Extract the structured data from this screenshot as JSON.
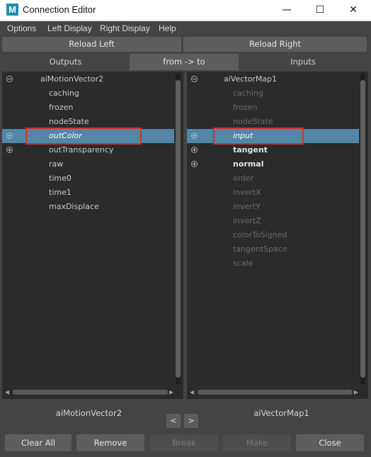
{
  "window": {
    "title": "Connection Editor",
    "app_icon": "M",
    "min_glyph": "—",
    "max_glyph": "☐",
    "close_glyph": "✕"
  },
  "menu": [
    "Options",
    "Left Display",
    "Right Display",
    "Help"
  ],
  "reload": {
    "left": "Reload Left",
    "right": "Reload Right"
  },
  "headers": {
    "outputs": "Outputs",
    "direction": "from -> to",
    "inputs": "Inputs"
  },
  "left_panel": {
    "node": "aiMotionVector2",
    "attributes": [
      {
        "label": "caching"
      },
      {
        "label": "frozen"
      },
      {
        "label": "nodeState"
      },
      {
        "label": "outColor"
      },
      {
        "label": "outTransparency"
      },
      {
        "label": "raw"
      },
      {
        "label": "time0"
      },
      {
        "label": "time1"
      },
      {
        "label": "maxDisplace"
      }
    ]
  },
  "right_panel": {
    "node": "aiVectorMap1",
    "attributes": [
      {
        "label": "caching"
      },
      {
        "label": "frozen"
      },
      {
        "label": "nodeState"
      },
      {
        "label": "input"
      },
      {
        "label": "tangent"
      },
      {
        "label": "normal"
      },
      {
        "label": "order"
      },
      {
        "label": "invertX"
      },
      {
        "label": "invertY"
      },
      {
        "label": "invertZ"
      },
      {
        "label": "colorToSigned"
      },
      {
        "label": "tangentSpace"
      },
      {
        "label": "scale"
      }
    ]
  },
  "footer": {
    "left_node": "aiMotionVector2",
    "right_node": "aiVectorMap1",
    "prev": "<",
    "next": ">"
  },
  "buttons": {
    "clear_all": "Clear All",
    "remove": "Remove",
    "break": "Break",
    "make": "Make",
    "close": "Close"
  },
  "colors": {
    "selection": "#5285a6",
    "highlight_box": "#d32f2f",
    "panel_bg": "#2b2b2b",
    "window_bg": "#444444"
  }
}
